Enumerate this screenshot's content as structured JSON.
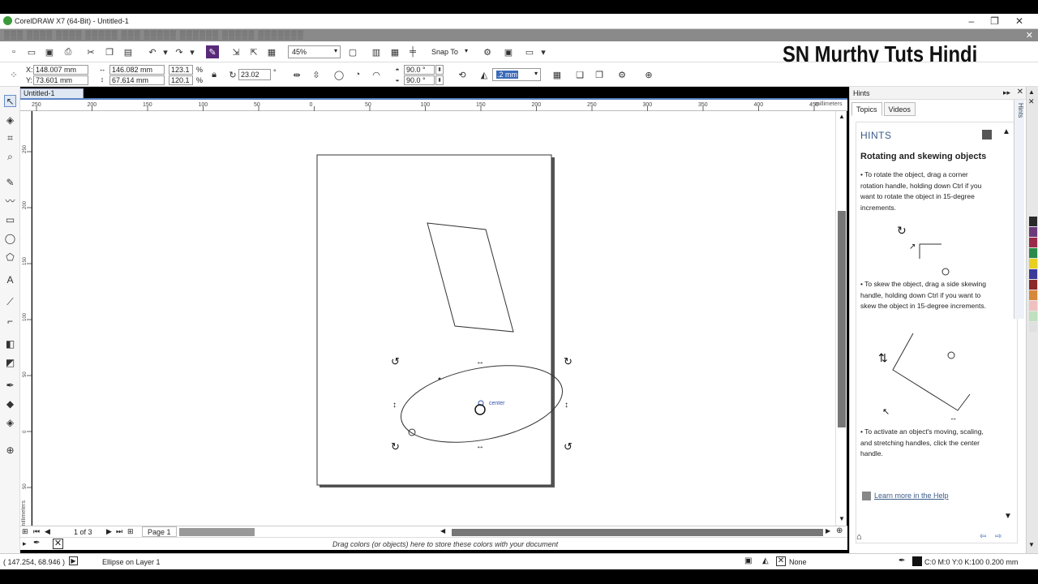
{
  "window": {
    "title": "CorelDRAW X7 (64-Bit) - Untitled-1",
    "minimize": "–",
    "maximize": "❐",
    "close": "✕"
  },
  "watermark": "SN Murthy Tuts Hindi",
  "std_toolbar": {
    "zoom_value": "45%",
    "snap_to": "Snap To"
  },
  "property_bar": {
    "x_label": "X:",
    "x_value": "148.007 mm",
    "y_label": "Y:",
    "y_value": "73.601 mm",
    "width_value": "146.082 mm",
    "height_value": "67.614 mm",
    "scale_w": "123.1",
    "scale_h": "120.1",
    "pct": "%",
    "rotation": "23.02",
    "degree": "°",
    "angle_start": "90.0 °",
    "angle_end": "90.0 °",
    "outline_width": ".2 mm"
  },
  "document_tab": "Untitled-1",
  "ruler": {
    "h_ticks": [
      "250",
      "200",
      "150",
      "100",
      "50",
      "0",
      "50",
      "100",
      "150",
      "200",
      "250",
      "300",
      "350",
      "400",
      "450"
    ],
    "units": "millimeters",
    "v_ticks": [
      "250",
      "200",
      "150",
      "100",
      "50",
      "0",
      "50"
    ],
    "v_units": "millimeters"
  },
  "canvas": {
    "center_label": "center"
  },
  "pagebar": {
    "page_count": "1 of 3",
    "page_tab": "Page 1"
  },
  "palette_hint": "Drag colors (or objects) here to store these colors with your document",
  "status": {
    "coords": "( 147.254, 68.946 )",
    "object_info": "Ellipse on Layer 1",
    "fill": "None",
    "outline": "C:0 M:0 Y:0 K:100  0.200 mm"
  },
  "docker": {
    "header": "Hints",
    "tabs": [
      "Topics",
      "Videos"
    ],
    "hints_title": "HINTS",
    "heading": "Rotating and skewing objects",
    "p1": "• To rotate the object, drag a corner rotation handle, holding down Ctrl if you want to rotate the object in 15-degree increments.",
    "p2": "• To skew the object, drag a side skewing handle, holding down Ctrl if you want to skew the object in 15-degree increments.",
    "p3": "• To activate an object's moving, scaling, and stretching handles, click the center handle.",
    "help_link": "Learn more in the Help",
    "side_tab": "Hints"
  },
  "colors": {
    "accent": "#5b85c6",
    "swatches": [
      "#2a2a2a",
      "#6b3a7a",
      "#9b2a4a",
      "#2a8a4a",
      "#e8d020",
      "#3a3a9a",
      "#8a2a2a",
      "#d8883a",
      "#f0c0c0",
      "#c0e0c0",
      "#e0e0e0"
    ]
  }
}
